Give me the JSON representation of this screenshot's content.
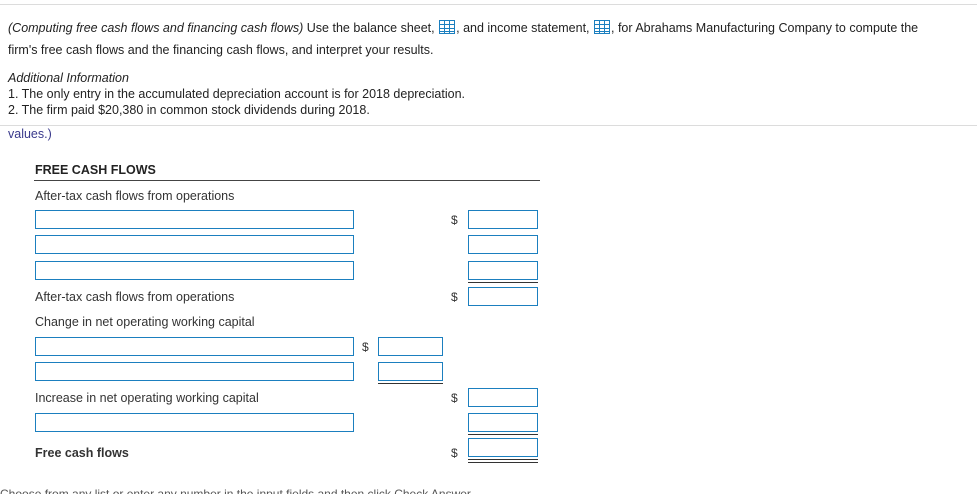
{
  "intro": {
    "part1": "(Computing free cash flows and financing cash flows)",
    "part2": " Use the balance sheet,",
    "part3": ", and income statement,",
    "part4": ", for Abrahams Manufacturing Company to compute the",
    "line2": "firm's free cash flows and the financing cash flows, and interpret your results.",
    "icons": [
      "balance-sheet-icon",
      "income-statement-icon"
    ]
  },
  "additional": {
    "heading": "Additional Information",
    "items": [
      "1. The only entry in the accumulated depreciation account is for 2018 depreciation.",
      "2. The firm paid $20,380 in common stock dividends during 2018."
    ]
  },
  "values_text": "values.)",
  "form": {
    "title": "FREE CASH FLOWS",
    "after_tax_heading": "After-tax cash flows from operations",
    "after_tax_total": "After-tax cash flows from operations",
    "change_nowc": "Change in net operating working capital",
    "increase_nowc": "Increase in net operating working capital",
    "free_cash_flows": "Free cash flows",
    "currency": "$",
    "inputs": {
      "text_values": [
        "",
        "",
        "",
        "",
        "",
        ""
      ],
      "amount_values": [
        "",
        "",
        "",
        "",
        "",
        "",
        "",
        "",
        ""
      ]
    }
  },
  "bottom_partial_text": "Choose from any list or enter any number in the input fields and then click Check Answer."
}
